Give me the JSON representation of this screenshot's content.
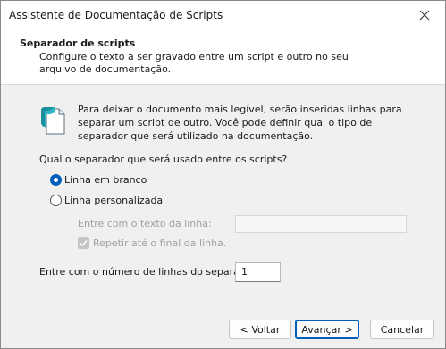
{
  "window": {
    "title": "Assistente de Documentação de Scripts"
  },
  "header": {
    "title": "Separador de scripts",
    "description": "Configure o texto a ser gravado entre um script e outro no seu arquivo de documentação."
  },
  "info": {
    "icon": "document-icon",
    "text": "Para deixar o documento mais legível, serão inseridas linhas para separar um script de outro. Você pode definir qual o tipo de separador que será utilizado na documentação."
  },
  "question": "Qual o separador que será usado entre os scripts?",
  "options": {
    "blank_line": {
      "label": "Linha em branco",
      "checked": true
    },
    "custom_line": {
      "label": "Linha personalizada",
      "checked": false
    }
  },
  "custom": {
    "text_label": "Entre com o texto da linha:",
    "text_value": "",
    "repeat_label": "Repetir até o final da linha.",
    "repeat_checked": true
  },
  "lines": {
    "label": "Entre com o número de linhas do separador:",
    "value": "1"
  },
  "buttons": {
    "back": "< Voltar",
    "next": "Avançar >",
    "cancel": "Cancelar"
  },
  "colors": {
    "accent": "#005fb8",
    "icon_teal": "#1a8f9e"
  }
}
